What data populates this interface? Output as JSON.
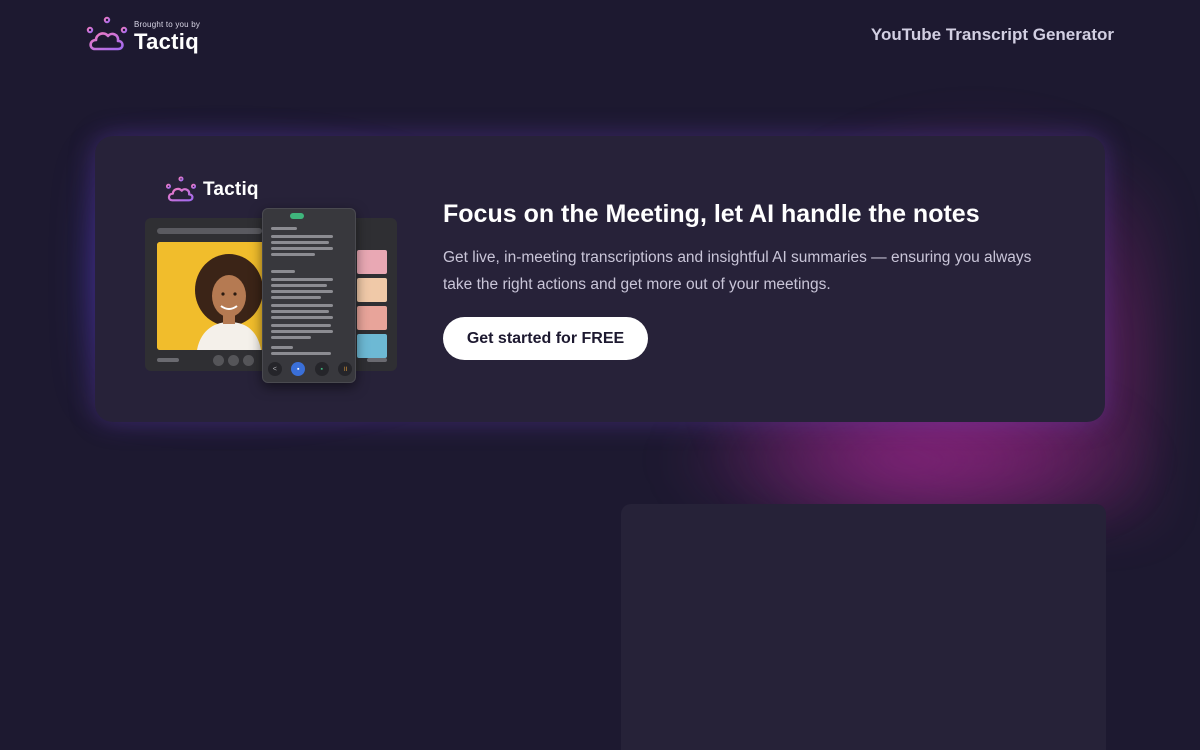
{
  "header": {
    "brought_by": "Brought to you by",
    "brand_name": "Tactiq",
    "nav_link": "YouTube Transcript Generator"
  },
  "promo": {
    "logo_text": "Tactiq",
    "title": "Focus on the Meeting, let AI handle the notes",
    "description": "Get live, in-meeting transcriptions and insightful AI summaries — ensuring you always take the right actions and get more out of your meetings.",
    "cta_label": "Get started for FREE"
  },
  "colors": {
    "background": "#1d1930",
    "card": "#272239",
    "brand_gradient_start": "#e77ad0",
    "brand_gradient_end": "#9b6cf0",
    "cta_bg": "#ffffff"
  },
  "icons": {
    "brand": "cloud-logo-icon"
  }
}
